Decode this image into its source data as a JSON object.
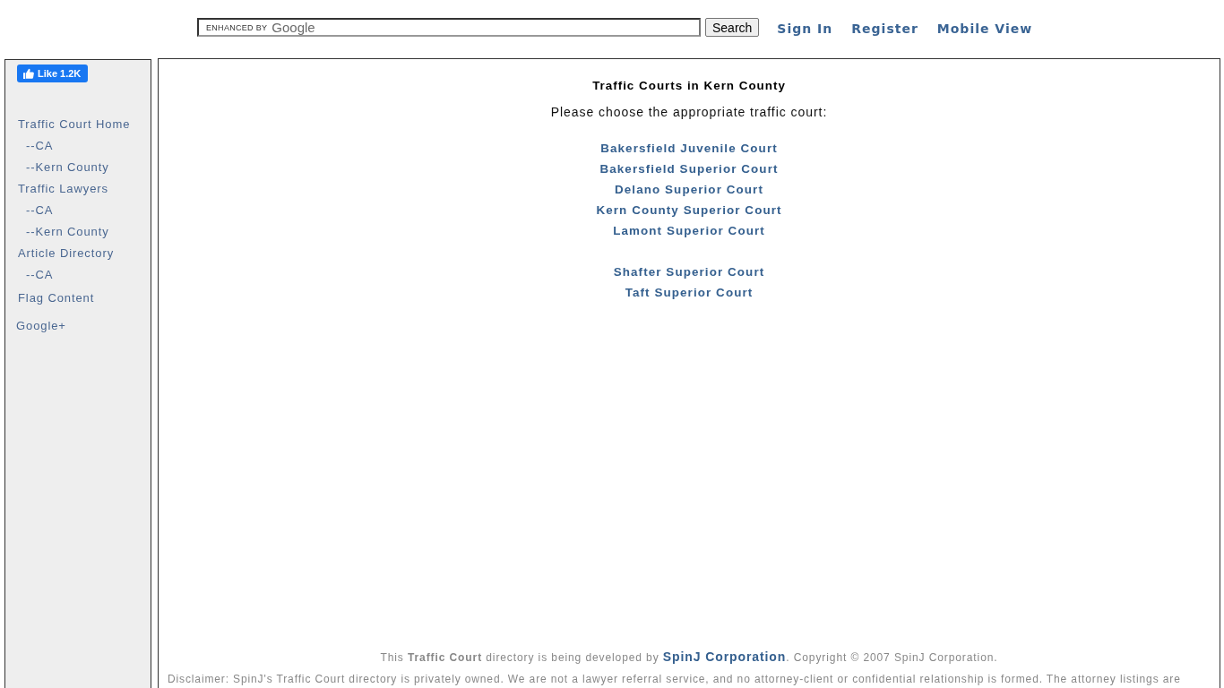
{
  "header": {
    "search": {
      "branding_prefix": "ENHANCED BY",
      "branding_name": "Google",
      "button": "Search"
    },
    "links": [
      "Sign In",
      "Register",
      "Mobile View"
    ]
  },
  "sidebar": {
    "like_button": {
      "label": "Like",
      "count": "1.2K"
    },
    "nav": [
      {
        "label": "Traffic Court Home",
        "children": [
          {
            "label": "--CA"
          },
          {
            "label": "--Kern County"
          }
        ]
      },
      {
        "label": "Traffic Lawyers",
        "children": [
          {
            "label": "--CA"
          },
          {
            "label": "--Kern County"
          }
        ]
      },
      {
        "label": "Article Directory",
        "children": [
          {
            "label": "--CA"
          }
        ]
      }
    ],
    "flag_link": "Flag Content",
    "social_link": "Google+"
  },
  "main": {
    "title": "Traffic Courts in Kern County",
    "intro": "Please choose the appropriate traffic court:",
    "court_groups": [
      [
        "Bakersfield Juvenile Court",
        "Bakersfield Superior Court",
        "Delano Superior Court",
        "Kern County Superior Court",
        "Lamont Superior Court"
      ],
      [
        "Shafter Superior Court",
        "Taft Superior Court"
      ]
    ]
  },
  "footer": {
    "credit_before": "This **Traffic Court** directory is being developed by",
    "credit_link": "SpinJ Corporation",
    "credit_after": ". Copyright © 2007 SpinJ Corporation.",
    "disclaimer": "Disclaimer: SpinJ's Traffic Court directory is privately owned. We are not a lawyer referral service, and no attorney-client or confidential relationship is formed. The attorney listings are"
  }
}
